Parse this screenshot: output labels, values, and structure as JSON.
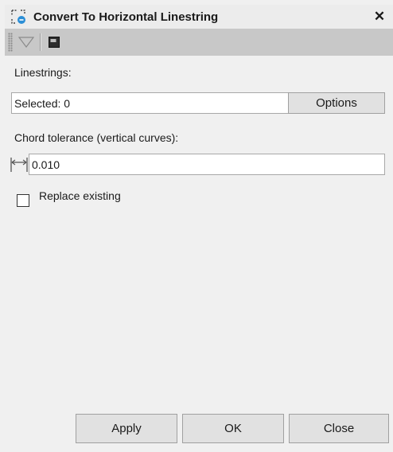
{
  "dialog": {
    "title": "Convert To Horizontal Linestring",
    "close_glyph": "✕",
    "icon": "linestring-icon"
  },
  "toolbar": {
    "items": [
      "filter-dropdown-icon",
      "command-prompt-icon"
    ]
  },
  "linestrings": {
    "label": "Linestrings:",
    "selection_value": "Selected: 0",
    "options_label": "Options"
  },
  "chord": {
    "label": "Chord tolerance (vertical curves):",
    "value": "0.010",
    "icon": "distance-icon"
  },
  "replace": {
    "label": "Replace existing",
    "checked": false
  },
  "footer": {
    "apply_label": "Apply",
    "ok_label": "OK",
    "close_label": "Close"
  },
  "colors": {
    "panel_bg": "#f0f0f0",
    "toolbar_bg": "#c8c8c8",
    "accent": "#2b8ed6"
  }
}
